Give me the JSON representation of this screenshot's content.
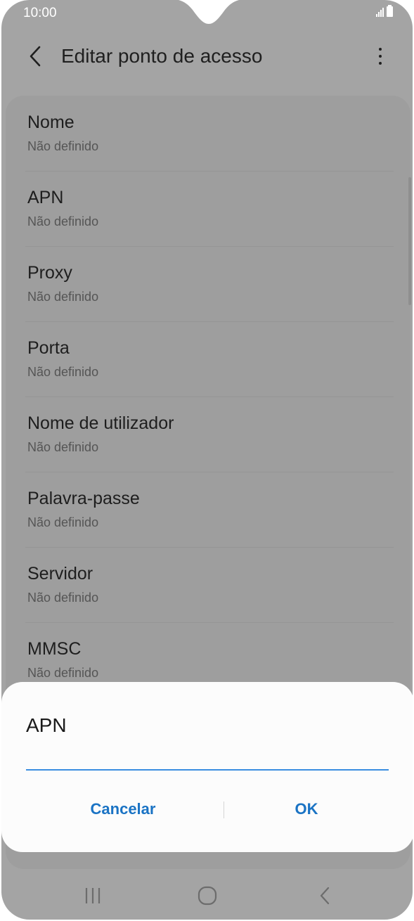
{
  "status_bar": {
    "time": "10:00"
  },
  "app_bar": {
    "title": "Editar ponto de acesso"
  },
  "settings": {
    "items": [
      {
        "title": "Nome",
        "summary": "Não definido"
      },
      {
        "title": "APN",
        "summary": "Não definido"
      },
      {
        "title": "Proxy",
        "summary": "Não definido"
      },
      {
        "title": "Porta",
        "summary": "Não definido"
      },
      {
        "title": "Nome de utilizador",
        "summary": "Não definido"
      },
      {
        "title": "Palavra-passe",
        "summary": "Não definido"
      },
      {
        "title": "Servidor",
        "summary": "Não definido"
      },
      {
        "title": "MMSC",
        "summary": "Não definido"
      }
    ]
  },
  "dialog": {
    "title": "APN",
    "input_value": "",
    "cancel_label": "Cancelar",
    "ok_label": "OK"
  },
  "icons": {
    "back": "chevron-left-icon",
    "more": "more-vertical-icon",
    "signal": "signal-icon",
    "battery": "battery-icon",
    "nav_recents": "recents-icon",
    "nav_home": "home-icon",
    "nav_back": "back-icon"
  },
  "colors": {
    "accent": "#1a73c4",
    "input_underline": "#3a8ee0",
    "scrim": "#a4a4a4",
    "dialog_background": "#fcfcfc"
  }
}
